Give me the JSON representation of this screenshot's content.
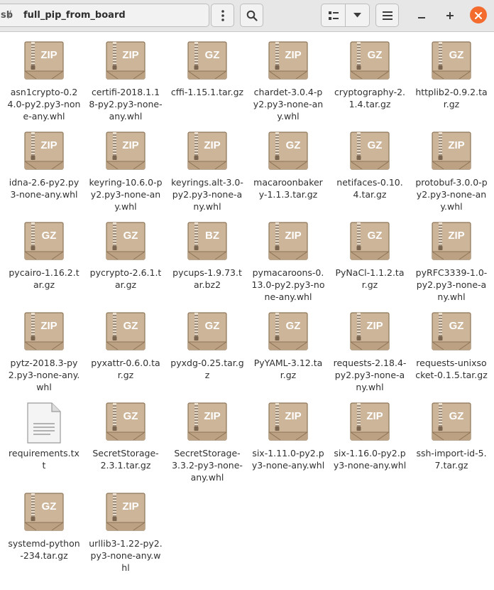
{
  "header": {
    "prev_crumb": "sb",
    "separator": "/",
    "current_folder": "full_pip_from_board"
  },
  "colors": {
    "archive_box": "#cdb599",
    "archive_box_top": "#bca283",
    "close_button": "#f46b2e"
  },
  "files": [
    {
      "name": "asn1crypto-0.24.0-py2.py3-none-any.whl",
      "type": "ZIP"
    },
    {
      "name": "certifi-2018.1.18-py2.py3-none-any.whl",
      "type": "ZIP"
    },
    {
      "name": "cffi-1.15.1.tar.gz",
      "type": "GZ"
    },
    {
      "name": "chardet-3.0.4-py2.py3-none-any.whl",
      "type": "ZIP"
    },
    {
      "name": "cryptography-2.1.4.tar.gz",
      "type": "GZ"
    },
    {
      "name": "httplib2-0.9.2.tar.gz",
      "type": "GZ"
    },
    {
      "name": "idna-2.6-py2.py3-none-any.whl",
      "type": "ZIP"
    },
    {
      "name": "keyring-10.6.0-py2.py3-none-any.whl",
      "type": "ZIP"
    },
    {
      "name": "keyrings.alt-3.0-py2.py3-none-any.whl",
      "type": "ZIP"
    },
    {
      "name": "macaroonbakery-1.1.3.tar.gz",
      "type": "GZ"
    },
    {
      "name": "netifaces-0.10.4.tar.gz",
      "type": "GZ"
    },
    {
      "name": "protobuf-3.0.0-py2.py3-none-any.whl",
      "type": "ZIP"
    },
    {
      "name": "pycairo-1.16.2.tar.gz",
      "type": "GZ"
    },
    {
      "name": "pycrypto-2.6.1.tar.gz",
      "type": "GZ"
    },
    {
      "name": "pycups-1.9.73.tar.bz2",
      "type": "BZ"
    },
    {
      "name": "pymacaroons-0.13.0-py2.py3-none-any.whl",
      "type": "ZIP"
    },
    {
      "name": "PyNaCl-1.1.2.tar.gz",
      "type": "GZ"
    },
    {
      "name": "pyRFC3339-1.0-py2.py3-none-any.whl",
      "type": "ZIP"
    },
    {
      "name": "pytz-2018.3-py2.py3-none-any.whl",
      "type": "ZIP"
    },
    {
      "name": "pyxattr-0.6.0.tar.gz",
      "type": "GZ"
    },
    {
      "name": "pyxdg-0.25.tar.gz",
      "type": "GZ"
    },
    {
      "name": "PyYAML-3.12.tar.gz",
      "type": "GZ"
    },
    {
      "name": "requests-2.18.4-py2.py3-none-any.whl",
      "type": "ZIP"
    },
    {
      "name": "requests-unixsocket-0.1.5.tar.gz",
      "type": "GZ"
    },
    {
      "name": "requirements.txt",
      "type": "TXT"
    },
    {
      "name": "SecretStorage-2.3.1.tar.gz",
      "type": "GZ"
    },
    {
      "name": "SecretStorage-3.3.2-py3-none-any.whl",
      "type": "ZIP"
    },
    {
      "name": "six-1.11.0-py2.py3-none-any.whl",
      "type": "ZIP"
    },
    {
      "name": "six-1.16.0-py2.py3-none-any.whl",
      "type": "ZIP"
    },
    {
      "name": "ssh-import-id-5.7.tar.gz",
      "type": "GZ"
    },
    {
      "name": "systemd-python-234.tar.gz",
      "type": "GZ"
    },
    {
      "name": "urllib3-1.22-py2.py3-none-any.whl",
      "type": "ZIP"
    }
  ]
}
